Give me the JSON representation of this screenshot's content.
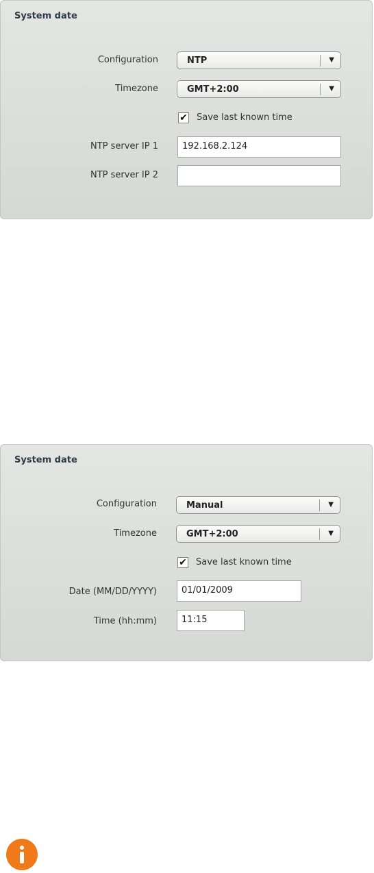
{
  "panels": [
    {
      "title": "System date",
      "configuration": {
        "label": "Configuration",
        "value": "NTP"
      },
      "timezone": {
        "label": "Timezone",
        "value": "GMT+2:00"
      },
      "save_time": {
        "label": "Save last known time",
        "checked": true,
        "mark": "✔"
      },
      "ntp1": {
        "label": "NTP server IP 1",
        "value": "192.168.2.124"
      },
      "ntp2": {
        "label": "NTP server IP 2",
        "value": ""
      }
    },
    {
      "title": "System date",
      "configuration": {
        "label": "Configuration",
        "value": "Manual"
      },
      "timezone": {
        "label": "Timezone",
        "value": "GMT+2:00"
      },
      "save_time": {
        "label": "Save last known time",
        "checked": true,
        "mark": "✔"
      },
      "date": {
        "label": "Date (MM/DD/YYYY)",
        "value": "01/01/2009"
      },
      "time": {
        "label": "Time (hh:mm)",
        "value": "11:15"
      }
    }
  ],
  "dropdown_arrow": "▼",
  "info_icon": "info-icon",
  "colors": {
    "accent_icon": "#f07a1a",
    "panel_bg": "#dcdedb",
    "title": "#2e3a46"
  }
}
